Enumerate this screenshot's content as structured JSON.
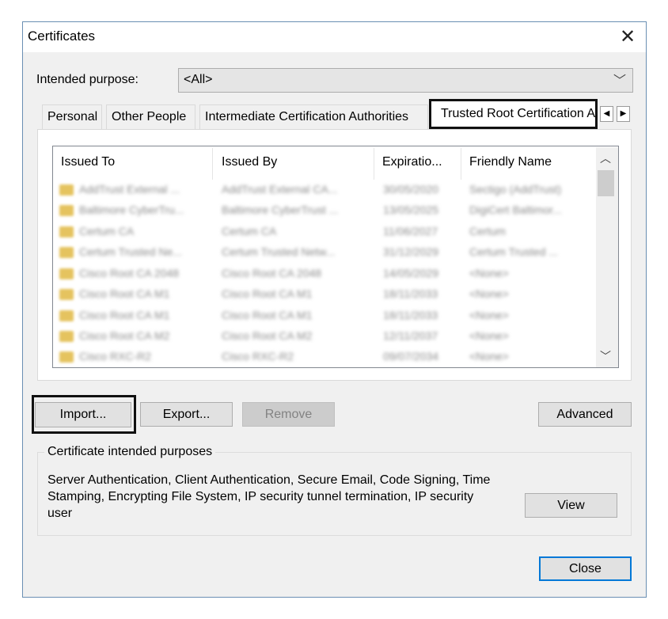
{
  "window": {
    "title": "Certificates",
    "close_glyph": "✕"
  },
  "purpose": {
    "label": "Intended purpose:",
    "value": "<All>"
  },
  "tabs": [
    "Personal",
    "Other People",
    "Intermediate Certification Authorities",
    "Trusted Root Certification Authorities"
  ],
  "columns": [
    "Issued To",
    "Issued By",
    "Expiratio...",
    "Friendly Name"
  ],
  "rows": [
    [
      "AddTrust External ...",
      "AddTrust External CA...",
      "30/05/2020",
      "Sectigo (AddTrust)"
    ],
    [
      "Baltimore CyberTru...",
      "Baltimore CyberTrust ...",
      "13/05/2025",
      "DigiCert Baltimor..."
    ],
    [
      "Certum CA",
      "Certum CA",
      "11/06/2027",
      "Certum"
    ],
    [
      "Certum Trusted Ne...",
      "Certum Trusted Netw...",
      "31/12/2029",
      "Certum Trusted ..."
    ],
    [
      "Cisco Root CA 2048",
      "Cisco Root CA 2048",
      "14/05/2029",
      "<None>"
    ],
    [
      "Cisco Root CA M1",
      "Cisco Root CA M1",
      "18/11/2033",
      "<None>"
    ],
    [
      "Cisco Root CA M1",
      "Cisco Root CA M1",
      "18/11/2033",
      "<None>"
    ],
    [
      "Cisco Root CA M2",
      "Cisco Root CA M2",
      "12/11/2037",
      "<None>"
    ],
    [
      "Cisco RXC-R2",
      "Cisco RXC-R2",
      "09/07/2034",
      "<None>"
    ]
  ],
  "buttons": {
    "import": "Import...",
    "export": "Export...",
    "remove": "Remove",
    "advanced": "Advanced",
    "view": "View",
    "close": "Close"
  },
  "purposes_group": {
    "label": "Certificate intended purposes",
    "lines": [
      "Server Authentication, Client Authentication, Secure Email, Code Signing, Time",
      "Stamping, Encrypting File System, IP security tunnel termination, IP security",
      "user"
    ]
  },
  "icons": [
    "close-icon",
    "chevron-down-icon",
    "tab-scroll-left-icon",
    "tab-scroll-right-icon",
    "scroll-up-icon",
    "scroll-down-icon",
    "certificate-icon"
  ]
}
